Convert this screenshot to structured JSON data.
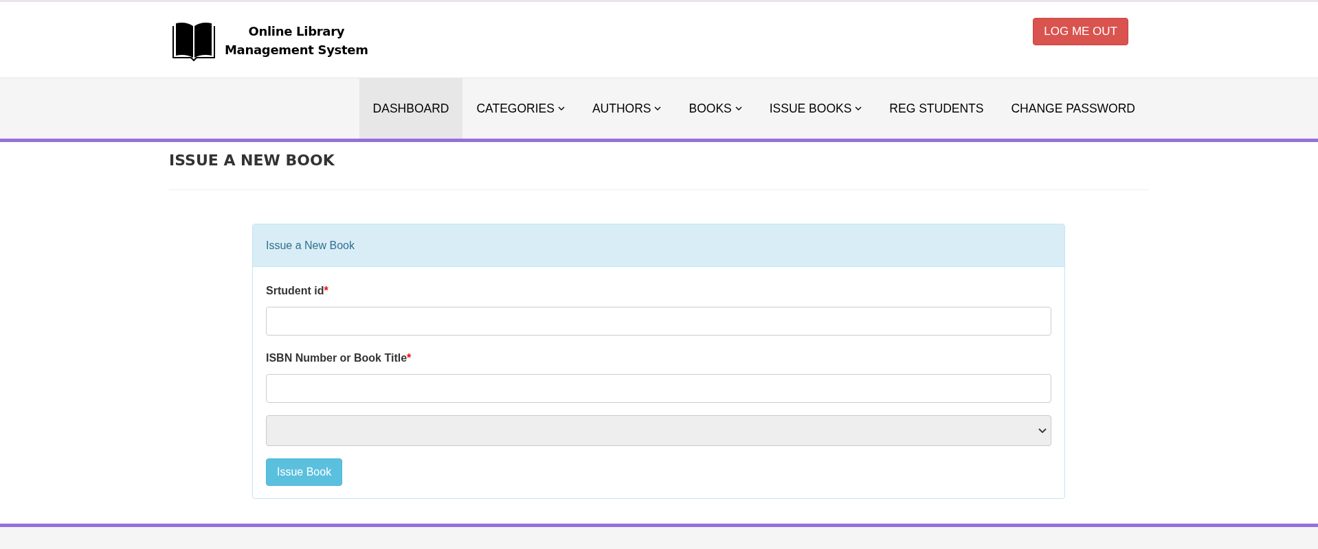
{
  "header": {
    "title_lines": [
      "Online Library",
      "Management System"
    ],
    "logout_button": "LOG ME OUT"
  },
  "nav": [
    {
      "kind": "link",
      "label": "DASHBOARD",
      "selected": true
    },
    {
      "kind": "dropdown",
      "label": "CATEGORIES",
      "selected": false
    },
    {
      "kind": "dropdown",
      "label": "AUTHORS",
      "selected": false
    },
    {
      "kind": "dropdown",
      "label": "BOOKS",
      "selected": false
    },
    {
      "kind": "dropdown",
      "label": "ISSUE BOOKS",
      "selected": false
    },
    {
      "kind": "link",
      "label": "REG STUDENTS",
      "selected": false
    },
    {
      "kind": "link",
      "label": "CHANGE PASSWORD",
      "selected": false
    }
  ],
  "page_heading": "ISSUE A NEW BOOK",
  "panel": {
    "title": "Issue a New Book",
    "fields": [
      {
        "kind": "text",
        "label": "Srtudent id",
        "required_mark": "*"
      },
      {
        "kind": "text",
        "label": "ISBN Number or Book Title",
        "required_mark": "*"
      },
      {
        "kind": "select"
      }
    ],
    "submit": "Issue Book"
  }
}
